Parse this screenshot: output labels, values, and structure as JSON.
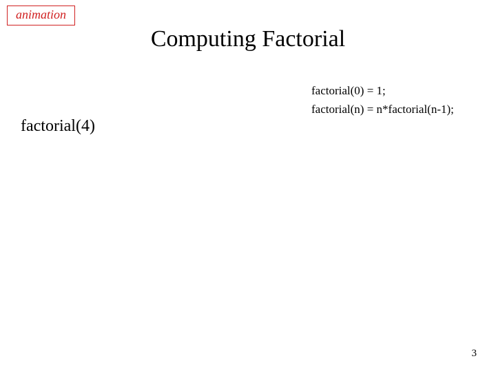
{
  "badge": {
    "label": "animation"
  },
  "title": "Computing Factorial",
  "definition": {
    "line1": "factorial(0) = 1;",
    "line2": "factorial(n) = n*factorial(n-1);"
  },
  "expression": "factorial(4)",
  "page_number": "3"
}
